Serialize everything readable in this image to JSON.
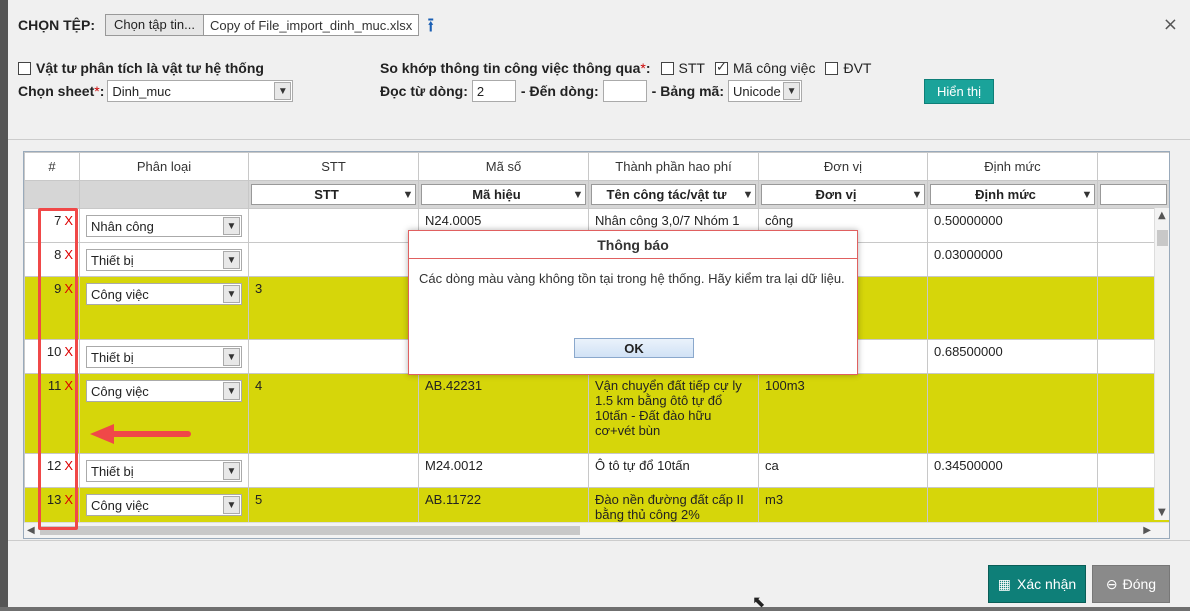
{
  "header": {
    "choose_file_label": "CHỌN TỆP:",
    "choose_file_button": "Chọn tập tin...",
    "file_name": "Copy of File_import_dinh_muc.xlsx",
    "close_symbol": "×"
  },
  "options": {
    "material_system_label": "Vật tư phân tích là vật tư hệ thống",
    "material_system_checked": false,
    "sheet_label": "Chọn sheet",
    "sheet_value": "Dinh_muc",
    "match_label": "So khớp thông tin công việc thông qua",
    "match_options": [
      {
        "label": "STT",
        "checked": false
      },
      {
        "label": "Mã công việc",
        "checked": true
      },
      {
        "label": "ĐVT",
        "checked": false
      }
    ],
    "from_row_label": "Đọc từ dòng:",
    "from_row_value": "2",
    "to_row_label": "- Đến dòng:",
    "to_row_value": "",
    "encoding_label": "- Bảng mã:",
    "encoding_value": "Unicode",
    "show_button": "Hiển thị",
    "required_mark": "*"
  },
  "table": {
    "headers": [
      "#",
      "Phân loại",
      "STT",
      "Mã số",
      "Thành phần hao phí",
      "Đơn vị",
      "Định mức",
      ""
    ],
    "filters": [
      "",
      "",
      "STT",
      "Mã hiệu",
      "Tên công tác/vật tư",
      "Đơn vị",
      "Định mức",
      ""
    ],
    "delete_symbol": "X",
    "rows": [
      {
        "num": "7",
        "type": "Nhân công",
        "stt": "",
        "code": "N24.0005",
        "name": "Nhân công 3,0/7 Nhóm 1",
        "unit": "công",
        "norm": "0.50000000",
        "highlight": false
      },
      {
        "num": "8",
        "type": "Thiết bị",
        "stt": "",
        "code": "",
        "name": "",
        "unit": "",
        "norm": "0.03000000",
        "highlight": false
      },
      {
        "num": "9",
        "type": "Công việc",
        "stt": "3",
        "code": "",
        "name": "",
        "unit": "",
        "norm": "",
        "highlight": true
      },
      {
        "num": "10",
        "type": "Thiết bị",
        "stt": "",
        "code": "",
        "name": "",
        "unit": "",
        "norm": "0.68500000",
        "highlight": false
      },
      {
        "num": "11",
        "type": "Công việc",
        "stt": "4",
        "code": "AB.42231",
        "name": "Vận chuyển đất tiếp cự ly 1.5 km bằng ôtô tự đổ 10tấn - Đất đào hữu cơ+vét bùn",
        "unit": "100m3",
        "norm": "",
        "highlight": true
      },
      {
        "num": "12",
        "type": "Thiết bị",
        "stt": "",
        "code": "M24.0012",
        "name": "Ô tô tự đổ 10tấn",
        "unit": "ca",
        "norm": "0.34500000",
        "highlight": false
      },
      {
        "num": "13",
        "type": "Công việc",
        "stt": "5",
        "code": "AB.11722",
        "name": "Đào nền đường đất cấp II bằng thủ công 2%",
        "unit": "m3",
        "norm": "",
        "highlight": true
      }
    ]
  },
  "modal": {
    "title": "Thông báo",
    "message": "Các dòng màu vàng không tồn tại trong hệ thống. Hãy kiểm tra lại dữ liệu.",
    "ok_button": "OK"
  },
  "footer": {
    "confirm_button": "Xác nhận",
    "close_button": "Đóng"
  },
  "colors": {
    "highlight_row": "#d6d60a",
    "primary_button": "#0e7f78",
    "show_button": "#1aa39a",
    "annotation_red": "#f04848"
  }
}
